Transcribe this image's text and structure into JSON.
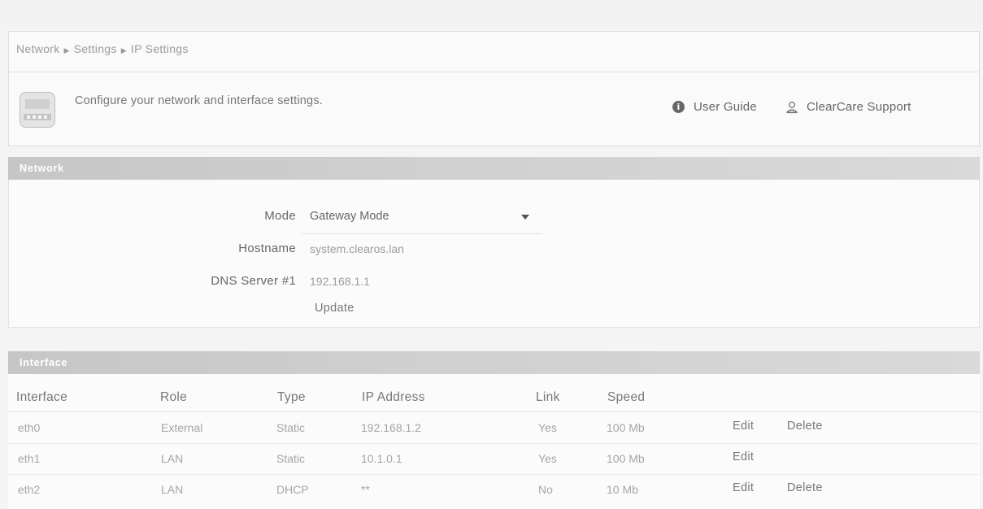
{
  "breadcrumb": {
    "items": [
      "Network",
      "Settings",
      "IP Settings"
    ]
  },
  "summary": {
    "description": "Configure your network and interface settings.",
    "links": {
      "user_guide": "User Guide",
      "support": "ClearCare Support"
    }
  },
  "network": {
    "header": "Network",
    "fields": {
      "mode": {
        "label": "Mode",
        "value": "Gateway Mode"
      },
      "hostname": {
        "label": "Hostname",
        "value": "system.clearos.lan"
      },
      "dns": {
        "label": "DNS Server #1",
        "value": "192.168.1.1"
      }
    },
    "update_label": "Update"
  },
  "interface": {
    "header": "Interface",
    "columns": [
      "Interface",
      "Role",
      "Type",
      "IP Address",
      "Link",
      "Speed"
    ],
    "rows": [
      {
        "iface": "eth0",
        "role": "External",
        "type": "Static",
        "ip": "192.168.1.2",
        "link": "Yes",
        "speed": "100 Mb",
        "edit": "Edit",
        "delete": "Delete"
      },
      {
        "iface": "eth1",
        "role": "LAN",
        "type": "Static",
        "ip": "10.1.0.1",
        "link": "Yes",
        "speed": "100 Mb",
        "edit": "Edit",
        "delete": ""
      },
      {
        "iface": "eth2",
        "role": "LAN",
        "type": "DHCP",
        "ip": "**",
        "link": "No",
        "speed": "10 Mb",
        "edit": "Edit",
        "delete": "Delete"
      }
    ]
  },
  "icons": [
    "app-network-icon",
    "info-icon",
    "person-icon",
    "chevron-down-icon"
  ]
}
